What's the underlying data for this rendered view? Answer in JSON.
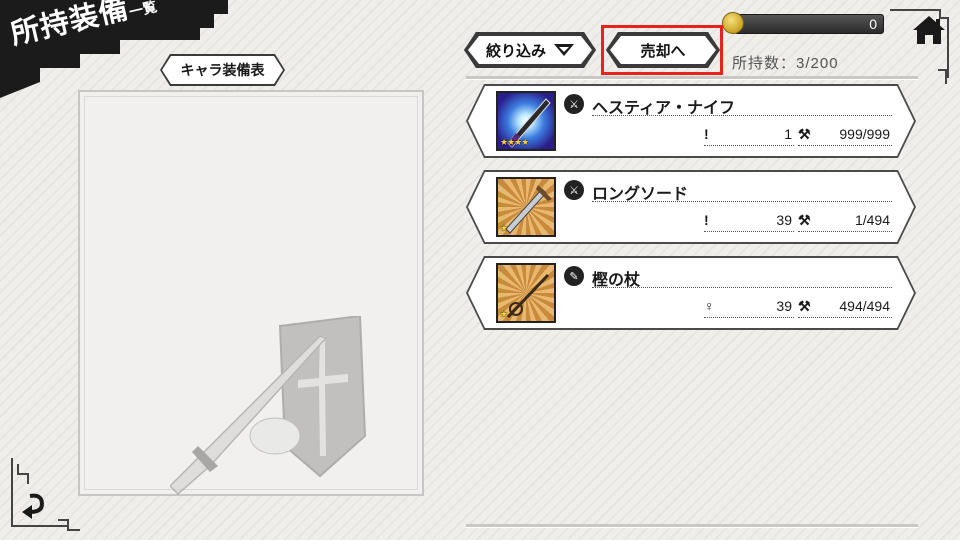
{
  "title": {
    "main": "所持装備",
    "sub": "一覧"
  },
  "header": {
    "coins": "0",
    "filter_label": "絞り込み",
    "sell_label": "売却へ",
    "count_label": "所持数：3/200"
  },
  "left_panel": {
    "tab_label": "キャラ装備表"
  },
  "equipment": [
    {
      "name": "ヘスティア・ナイフ",
      "type_icon": "dagger-icon",
      "stat_a": "1",
      "stat_b": "999/999",
      "rarity": 4,
      "thumb": "rare"
    },
    {
      "name": "ロングソード",
      "type_icon": "sword-icon",
      "stat_a": "39",
      "stat_b": "1/494",
      "rarity": 1,
      "thumb": "common"
    },
    {
      "name": "樫の杖",
      "type_icon": "staff-icon",
      "stat_a": "39",
      "stat_b": "494/494",
      "rarity": 1,
      "thumb": "common"
    }
  ],
  "colors": {
    "highlight": "#e8231c",
    "banner": "#1b1b1b",
    "coin": "#d4a92a"
  }
}
